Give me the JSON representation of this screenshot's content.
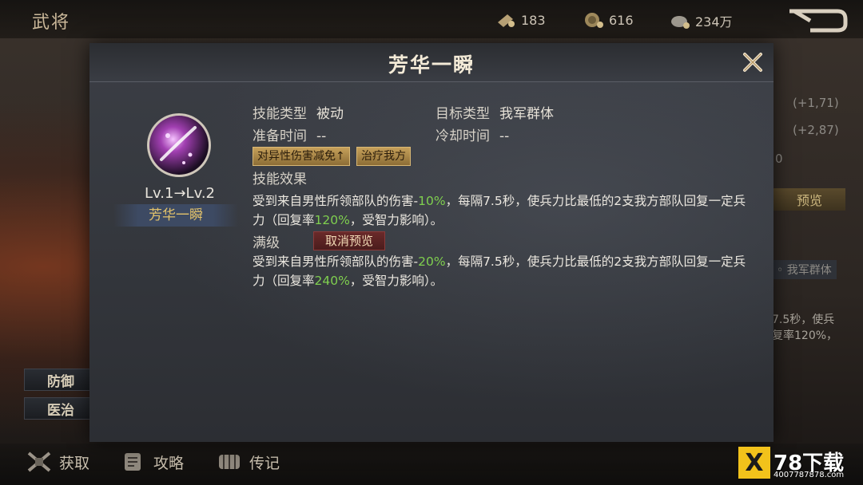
{
  "background": {
    "page_title": "武将",
    "resources": [
      {
        "icon": "ticket-icon",
        "value": "183"
      },
      {
        "icon": "coin-icon",
        "value": "616"
      },
      {
        "icon": "silver-icon",
        "value": "234万"
      }
    ],
    "right_stats": [
      "(+1,71)",
      "(+2,87)",
      "0"
    ],
    "preview_label": "预览",
    "target_fragment": "我军群体",
    "desc_fragment_1": "7.5秒，使兵",
    "desc_fragment_2": "复率120%，",
    "side_buttons": [
      "防御",
      "医治"
    ],
    "bottom_nav": [
      {
        "icon": "acquire-icon",
        "label": "获取"
      },
      {
        "icon": "strategy-icon",
        "label": "攻略"
      },
      {
        "icon": "biography-icon",
        "label": "传记"
      }
    ]
  },
  "dialog": {
    "title": "芳华一瞬",
    "level_text": "Lv.1→Lv.2",
    "skill_name": "芳华一瞬",
    "skill_type_label": "技能类型",
    "skill_type_value": "被动",
    "target_type_label": "目标类型",
    "target_type_value": "我军群体",
    "prep_time_label": "准备时间",
    "prep_time_value": "--",
    "cooldown_label": "冷却时间",
    "cooldown_value": "--",
    "tags": [
      "对异性伤害减免↑",
      "治疗我方"
    ],
    "effect_label": "技能效果",
    "effect_lv2": {
      "part1": "受到来自男性所领部队的伤害-",
      "num1": "10%",
      "part2": "，每隔7.5秒，使兵力比最低的2支我方部队回复一定兵力（回复率",
      "num2": "120%",
      "part3": "，受智力影响）。"
    },
    "max_level_label": "满级",
    "cancel_preview_label": "取消预览",
    "effect_max": {
      "part1": "受到来自男性所领部队的伤害-",
      "num1": "20%",
      "part2": "，每隔7.5秒，使兵力比最低的2支我方部队回复一定兵力（回复率",
      "num2": "240%",
      "part3": "，受智力影响）。"
    }
  },
  "watermark": {
    "logo": "X",
    "text": "78下载",
    "sub": "4007787878.com"
  },
  "colors": {
    "highlight_green": "#7fcf4f",
    "skill_name_gold": "#e3c36b",
    "tag_gold": "#c6a05a",
    "cancel_red": "#6a2a2a"
  }
}
